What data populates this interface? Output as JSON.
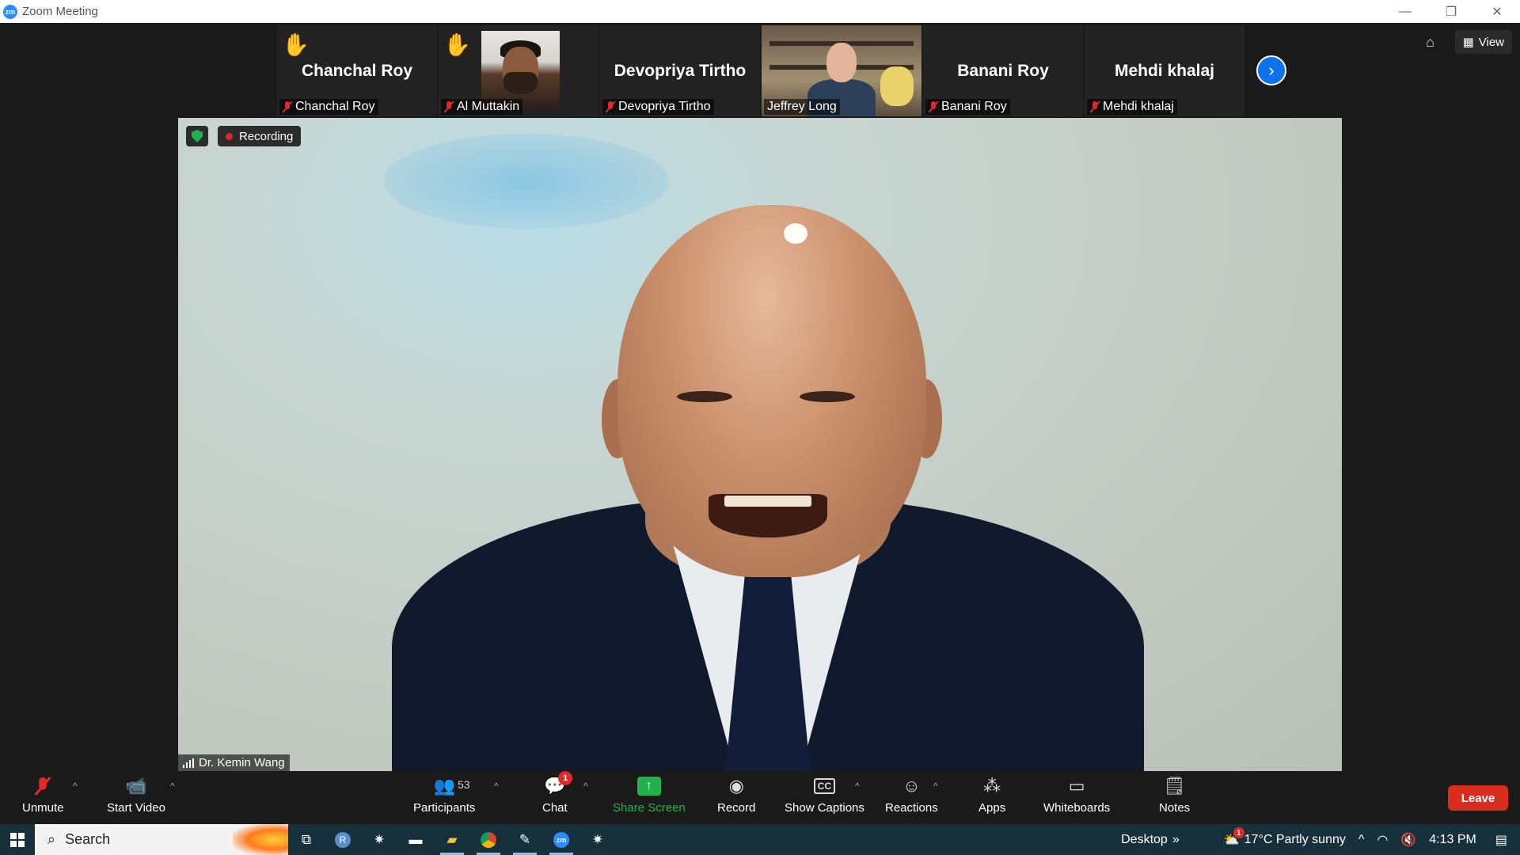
{
  "window": {
    "title": "Zoom Meeting",
    "app_badge": "zm"
  },
  "window_controls": {
    "minimize": "—",
    "restore": "❐",
    "close": "✕"
  },
  "thumbnails": [
    {
      "big_name": "Chanchal Roy",
      "label": "Chanchal Roy",
      "hand": "✋"
    },
    {
      "big_name": "",
      "label": "Al Muttakin",
      "hand": "✋"
    },
    {
      "big_name": "Devopriya Tirtho",
      "label": "Devopriya Tirtho",
      "hand": ""
    },
    {
      "big_name": "",
      "label": "Jeffrey Long",
      "hand": ""
    },
    {
      "big_name": "Banani Roy",
      "label": "Banani Roy",
      "hand": ""
    },
    {
      "big_name": "Mehdi khalaj",
      "label": "Mehdi khalaj",
      "hand": ""
    }
  ],
  "top_right": {
    "view_label": "View"
  },
  "main_video": {
    "recording_label": "Recording",
    "speaker_name": "Dr. Kemin Wang"
  },
  "toolbar": {
    "unmute": "Unmute",
    "start_video": "Start Video",
    "participants": "Participants",
    "participant_count": "53",
    "chat": "Chat",
    "chat_badge": "1",
    "share_screen": "Share Screen",
    "record": "Record",
    "show_captions": "Show Captions",
    "captions_icon_text": "CC",
    "reactions": "Reactions",
    "apps": "Apps",
    "whiteboards": "Whiteboards",
    "notes": "Notes",
    "leave": "Leave"
  },
  "taskbar": {
    "search_text": "Search",
    "desktop_label": "Desktop",
    "weather": "17°C  Partly sunny",
    "weather_badge": "1",
    "time": "4:13 PM",
    "zoom_icon_text": "zm",
    "r_icon_text": "R"
  },
  "colors": {
    "accent_blue": "#0e72ed",
    "share_green": "#23b14d",
    "leave_red": "#d92d20",
    "muted_red": "#e02828"
  }
}
